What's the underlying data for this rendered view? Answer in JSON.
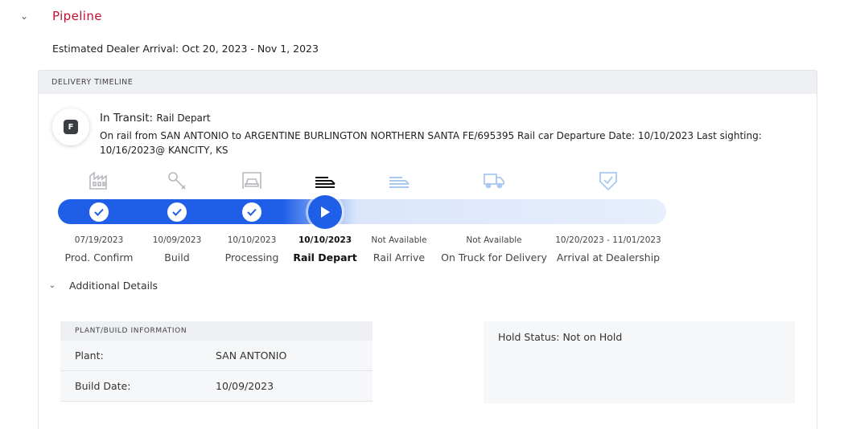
{
  "section": {
    "title": "Pipeline",
    "collapse_icon": "chevron-down-icon"
  },
  "eta": "Estimated Dealer Arrival: Oct 20, 2023 - Nov 1, 2023",
  "timeline": {
    "header": "DELIVERY TIMELINE",
    "status_badge": "F",
    "status_title": "In Transit:",
    "status_sub": "Rail Depart",
    "status_description": "On rail from SAN ANTONIO to ARGENTINE BURLINGTON NORTHERN SANTA FE/695395 Rail car Departure Date: 10/10/2023 Last sighting: 10/16/2023@ KANCITY, KS",
    "accent_color": "#1f5fe8",
    "steps": [
      {
        "name": "Prod. Confirm",
        "date": "07/19/2023",
        "icon": "factory-icon",
        "state": "complete"
      },
      {
        "name": "Build",
        "date": "10/09/2023",
        "icon": "wrench-icon",
        "state": "complete"
      },
      {
        "name": "Processing",
        "date": "10/10/2023",
        "icon": "car-processing-icon",
        "state": "complete"
      },
      {
        "name": "Rail Depart",
        "date": "10/10/2023",
        "icon": "rail-car-icon",
        "state": "current"
      },
      {
        "name": "Rail Arrive",
        "date": "Not Available",
        "icon": "rail-car-icon",
        "state": "pending"
      },
      {
        "name": "On Truck for Delivery",
        "date": "Not Available",
        "icon": "truck-icon",
        "state": "pending"
      },
      {
        "name": "Arrival at Dealership",
        "date": "10/20/2023 - 11/01/2023",
        "icon": "shield-check-icon",
        "state": "pending"
      }
    ]
  },
  "additional_details": {
    "label": "Additional Details",
    "plant_info": {
      "header": "PLANT/BUILD INFORMATION",
      "rows": [
        {
          "key": "Plant:",
          "value": "SAN ANTONIO"
        },
        {
          "key": "Build Date:",
          "value": "10/09/2023"
        }
      ]
    },
    "hold_status": "Hold Status: Not on Hold"
  }
}
